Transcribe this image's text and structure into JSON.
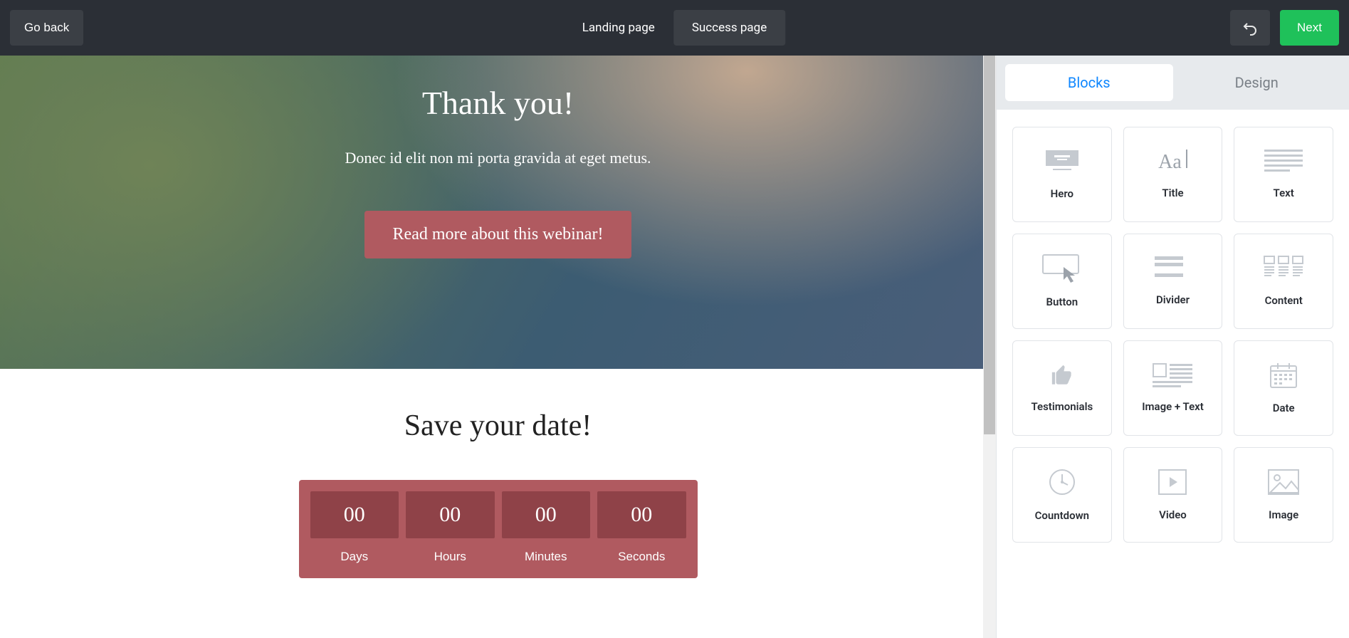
{
  "topbar": {
    "go_back": "Go back",
    "tabs": {
      "landing": "Landing page",
      "success": "Success page"
    },
    "next": "Next"
  },
  "canvas": {
    "hero": {
      "title": "Thank you!",
      "subtitle": "Donec id elit non mi porta gravida at eget metus.",
      "cta": "Read more about this webinar!"
    },
    "savedate": {
      "title": "Save your date!",
      "countdown": [
        {
          "value": "00",
          "label": "Days"
        },
        {
          "value": "00",
          "label": "Hours"
        },
        {
          "value": "00",
          "label": "Minutes"
        },
        {
          "value": "00",
          "label": "Seconds"
        }
      ]
    }
  },
  "panel": {
    "tabs": {
      "blocks": "Blocks",
      "design": "Design"
    },
    "blocks": [
      {
        "label": "Hero"
      },
      {
        "label": "Title"
      },
      {
        "label": "Text"
      },
      {
        "label": "Button"
      },
      {
        "label": "Divider"
      },
      {
        "label": "Content"
      },
      {
        "label": "Testimonials"
      },
      {
        "label": "Image + Text"
      },
      {
        "label": "Date"
      },
      {
        "label": "Countdown"
      },
      {
        "label": "Video"
      },
      {
        "label": "Image"
      }
    ]
  }
}
